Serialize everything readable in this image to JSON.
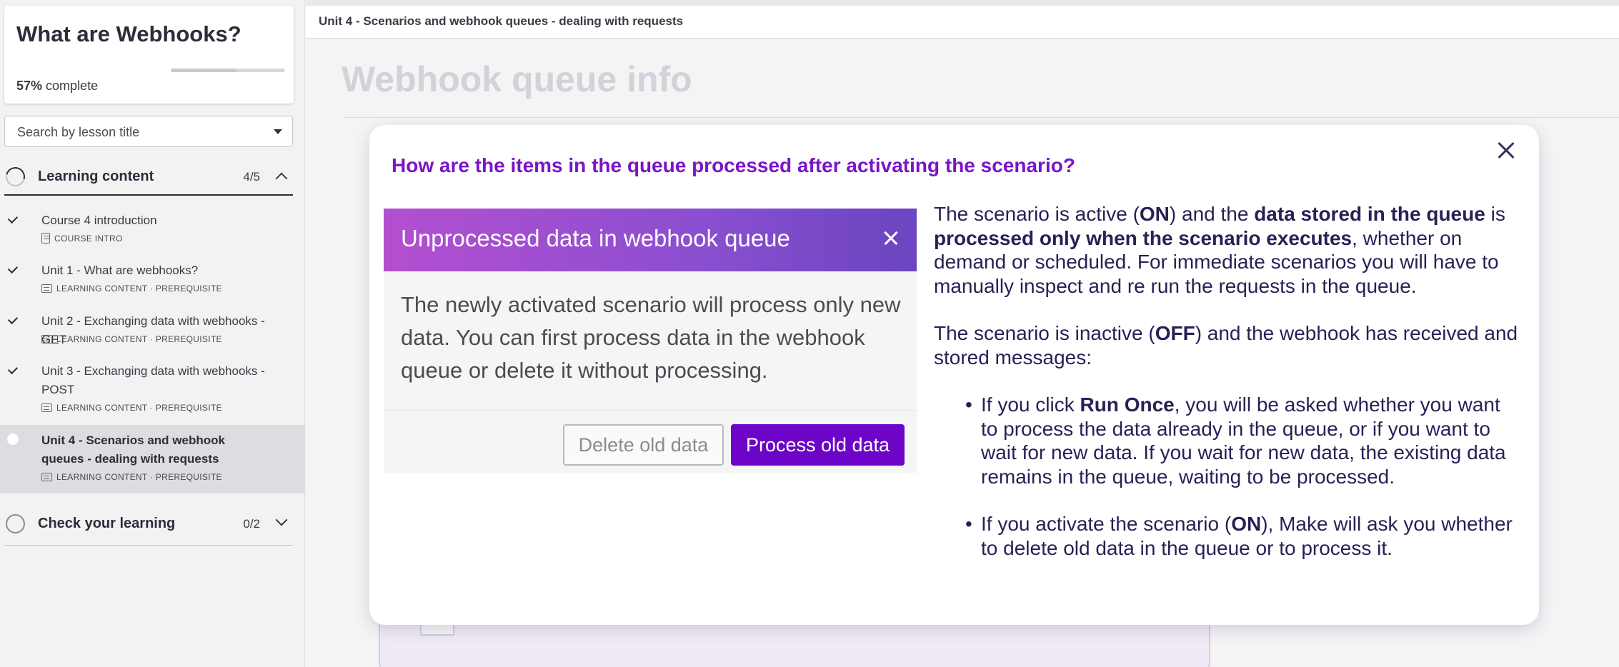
{
  "sidebar": {
    "course_title": "What are Webhooks?",
    "progress_percent": 57,
    "progress_value": "57%",
    "progress_suffix": "complete",
    "search_placeholder": "Search by lesson title",
    "sections": [
      {
        "label": "Learning content",
        "count": "4/5",
        "expanded": true,
        "lessons": [
          {
            "title": "Course 4 introduction",
            "meta": "COURSE INTRO",
            "completed": true,
            "active": false
          },
          {
            "title": "Unit 1 - What are webhooks?",
            "meta": "LEARNING CONTENT · PREREQUISITE",
            "completed": true,
            "active": false
          },
          {
            "title": "Unit 2 - Exchanging data with webhooks - GET",
            "meta": "LEARNING CONTENT · PREREQUISITE",
            "completed": true,
            "active": false
          },
          {
            "title": "Unit 3 - Exchanging data with webhooks - POST",
            "meta": "LEARNING CONTENT · PREREQUISITE",
            "completed": true,
            "active": false
          },
          {
            "title": "Unit 4 - Scenarios and webhook queues - dealing with requests",
            "meta": "LEARNING CONTENT · PREREQUISITE",
            "completed": false,
            "active": true
          }
        ]
      },
      {
        "label": "Check your learning",
        "count": "0/2",
        "expanded": false
      }
    ]
  },
  "main": {
    "breadcrumb": "Unit 4 - Scenarios and webhook queues - dealing with requests",
    "page_heading": "Webhook queue info"
  },
  "modal": {
    "question": "How are the items in the queue processed after activating the scenario?",
    "dialog": {
      "title": "Unprocessed data in webhook queue",
      "body": "The newly activated scenario will process only new data. You can first process data in the webhook queue or delete it without processing.",
      "delete_label": "Delete old data",
      "process_label": "Process old data"
    },
    "explanation": {
      "p1": {
        "a": "The scenario is active (",
        "b": "ON",
        "c": ") and the ",
        "d": "data stored in the queue",
        "e": " is ",
        "f": "processed only when the scenario executes",
        "g": ", whether on demand or scheduled. For immediate scenarios you will have to manually inspect and re run the requests in the queue."
      },
      "p2": {
        "a": "The scenario is inactive (",
        "b": "OFF",
        "c": ") and the webhook has received and stored messages:"
      },
      "bullet1": {
        "a": "If you click ",
        "b": "Run Once",
        "c": ", you will be asked whether you want to process the data already in the queue, or if you want to wait for new data. If you wait for new data, the existing data remains in the queue, waiting to be processed."
      },
      "bullet2": {
        "a": "If you activate the scenario (",
        "b": "ON",
        "c": "), Make will ask you whether to delete old data in the queue or to process it."
      }
    }
  },
  "colors": {
    "accent": "#7a14c9",
    "primary_button": "#6d05c9",
    "text_dark": "#2a1f55"
  }
}
